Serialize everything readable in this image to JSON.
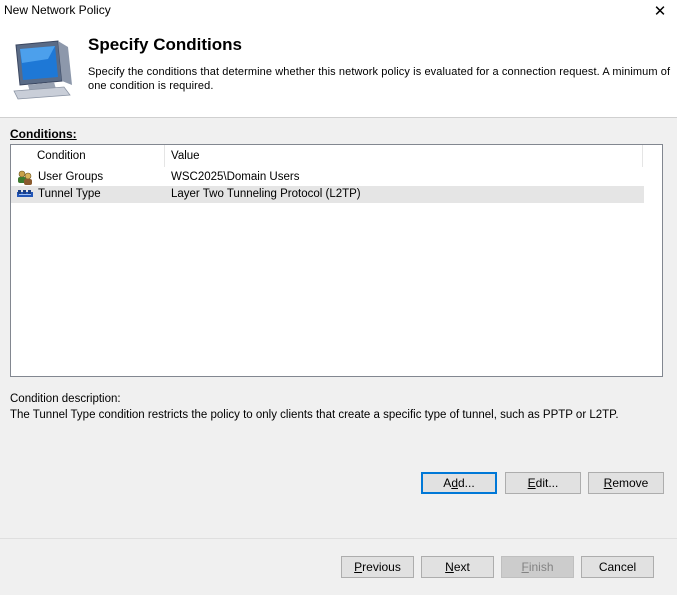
{
  "window": {
    "title": "New Network Policy",
    "close_glyph": "✕"
  },
  "header": {
    "title": "Specify Conditions",
    "description": "Specify the conditions that determine whether this network policy is evaluated for a connection request. A minimum of one condition is required.",
    "icon": "computer-monitor-icon"
  },
  "conditions": {
    "label": "Conditions:",
    "columns": [
      "Condition",
      "Value"
    ],
    "rows": [
      {
        "condition": "User Groups",
        "value": "WSC2025\\Domain Users",
        "icon": "user-groups-icon",
        "selected": false
      },
      {
        "condition": "Tunnel Type",
        "value": "Layer Two Tunneling Protocol (L2TP)",
        "icon": "tunnel-type-icon",
        "selected": true
      }
    ]
  },
  "description": {
    "label": "Condition description:",
    "text": "The Tunnel Type condition restricts the policy to only clients that create a specific type of tunnel, such as PPTP or L2TP."
  },
  "actions": {
    "add": {
      "pre": "A",
      "key": "d",
      "post": "d..."
    },
    "edit": {
      "pre": "",
      "key": "E",
      "post": "dit..."
    },
    "remove": {
      "pre": "",
      "key": "R",
      "post": "emove"
    }
  },
  "footer": {
    "previous": {
      "pre": "",
      "key": "P",
      "post": "revious"
    },
    "next": {
      "pre": "",
      "key": "N",
      "post": "ext"
    },
    "finish": {
      "pre": "",
      "key": "F",
      "post": "inish",
      "disabled": true
    },
    "cancel": "Cancel"
  },
  "colors": {
    "accent": "#0078d7",
    "selected_row": "#e5e5e5",
    "dialog_bg": "#f0f0f0"
  }
}
